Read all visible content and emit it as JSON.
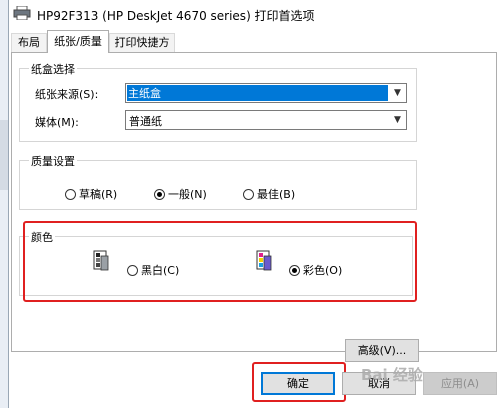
{
  "window": {
    "title": "HP92F313 (HP DeskJet 4670 series) 打印首选项"
  },
  "tabs": [
    {
      "label": "布局"
    },
    {
      "label": "纸张/质量"
    },
    {
      "label": "打印快捷方式"
    }
  ],
  "tray_group": {
    "title": "纸盒选择",
    "source_label": "纸张来源(S):",
    "source_value": "主纸盒",
    "media_label": "媒体(M):",
    "media_value": "普通纸"
  },
  "quality_group": {
    "title": "质量设置",
    "options": [
      {
        "label": "草稿(R)",
        "selected": false
      },
      {
        "label": "一般(N)",
        "selected": true
      },
      {
        "label": "最佳(B)",
        "selected": false
      }
    ]
  },
  "color_group": {
    "title": "颜色",
    "options": [
      {
        "label": "黑白(C)",
        "icon": "black-white-icon",
        "selected": false
      },
      {
        "label": "彩色(O)",
        "icon": "color-icon",
        "selected": true
      }
    ]
  },
  "buttons": {
    "advanced": "高级(V)...",
    "ok": "确定",
    "cancel": "取消",
    "apply": "应用(A)"
  },
  "watermark": {
    "text": "Bai 经验"
  },
  "colors": {
    "selection": "#0078d7",
    "highlight_border": "#e02020"
  }
}
